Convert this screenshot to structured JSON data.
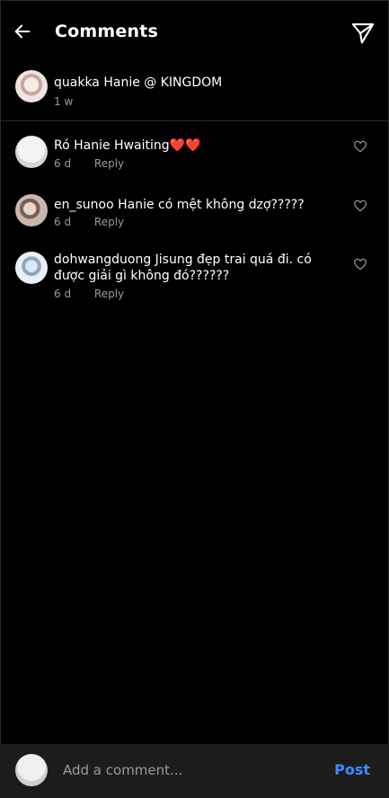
{
  "header": {
    "title": "Comments",
    "back_icon": "arrow-left-icon",
    "send_icon": "send-icon"
  },
  "caption": {
    "text": "quakka Hanie @ KINGDOM",
    "time": "1 w"
  },
  "comments": [
    {
      "text": "Ró Hanie Hwaiting❤️❤️",
      "time": "6 d",
      "reply": "Reply"
    },
    {
      "text": "en_sunoo Hanie có mệt không dzợ?????",
      "time": "6 d",
      "reply": "Reply"
    },
    {
      "text": "dohwangduong Jisung đẹp trai quá đi. có được giải gì không đó??????",
      "time": "6 d",
      "reply": "Reply"
    }
  ],
  "composer": {
    "placeholder": "Add a comment...",
    "post_label": "Post"
  },
  "colors": {
    "background": "#000000",
    "accent": "#3b8cff",
    "muted": "#9a9a9a",
    "composer_bg": "#1c1c1c"
  }
}
